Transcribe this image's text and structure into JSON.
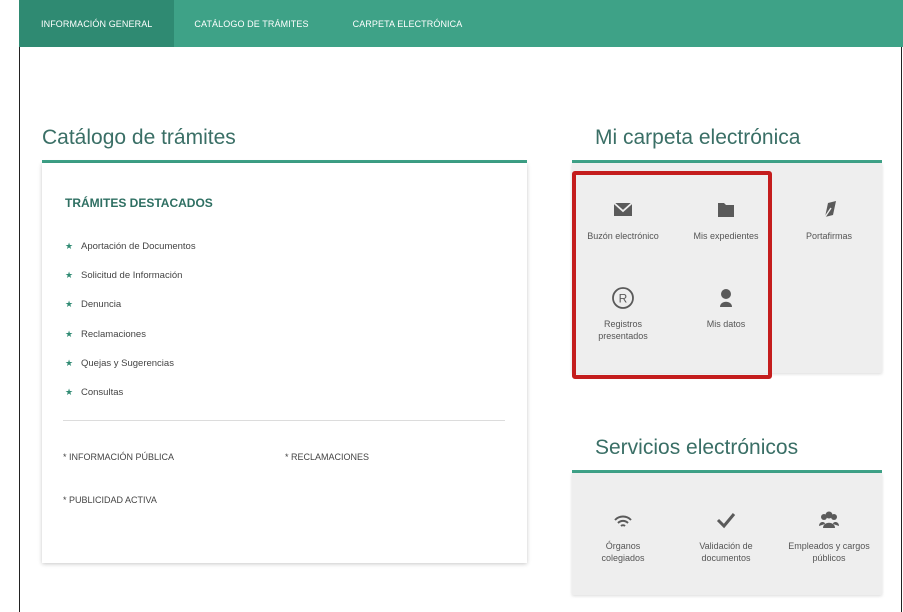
{
  "nav": {
    "items": [
      {
        "label": "INFORMACIÓN GENERAL"
      },
      {
        "label": "CATÁLOGO DE TRÁMITES"
      },
      {
        "label": "CARPETA ELECTRÓNICA"
      }
    ]
  },
  "catalog": {
    "title": "Catálogo de trámites",
    "featured_heading": "TRÁMITES DESTACADOS",
    "items": [
      {
        "label": "Aportación de Documentos"
      },
      {
        "label": "Solicitud de Información"
      },
      {
        "label": "Denuncia"
      },
      {
        "label": "Reclamaciones"
      },
      {
        "label": "Quejas y Sugerencias"
      },
      {
        "label": "Consultas"
      }
    ],
    "links": {
      "informacion_publica": "* INFORMACIÓN PÚBLICA",
      "reclamaciones": "* RECLAMACIONES",
      "publicidad_activa": "* PUBLICIDAD ACTIVA"
    }
  },
  "folder": {
    "title": "Mi carpeta electrónica",
    "tiles": [
      {
        "label": "Buzón electrónico",
        "icon": "envelope-icon"
      },
      {
        "label": "Mis expedientes",
        "icon": "folder-icon"
      },
      {
        "label": "Portafirmas",
        "icon": "pen-nib-icon"
      },
      {
        "label": "Registros presentados",
        "icon": "registered-icon"
      },
      {
        "label": "Mis datos",
        "icon": "user-icon"
      }
    ]
  },
  "services": {
    "title": "Servicios electrónicos",
    "tiles": [
      {
        "label": "Órganos colegiados",
        "icon": "signal-icon"
      },
      {
        "label": "Validación de documentos",
        "icon": "checkmark-icon"
      },
      {
        "label": "Empleados y cargos públicos",
        "icon": "group-icon"
      }
    ]
  },
  "colors": {
    "accent": "#3ea287",
    "accent_dark": "#2f8a72",
    "highlight": "#c41d1d"
  }
}
